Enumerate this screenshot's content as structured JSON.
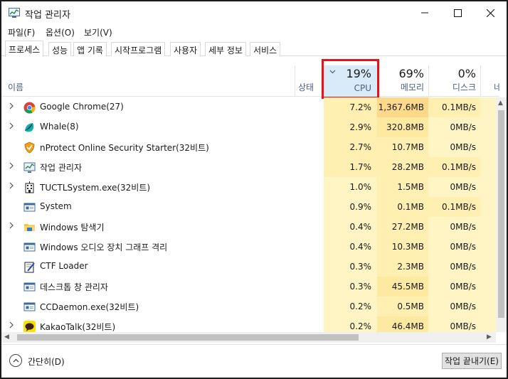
{
  "window": {
    "title": "작업 관리자"
  },
  "menu": [
    "파일(F)",
    "옵션(O)",
    "보기(V)"
  ],
  "tabs": [
    "프로세스",
    "성능",
    "앱 기록",
    "시작프로그램",
    "사용자",
    "세부 정보",
    "서비스"
  ],
  "columns": {
    "name": "이름",
    "status": "상태",
    "cpu": {
      "pct": "19%",
      "label": "CPU"
    },
    "memory": {
      "pct": "69%",
      "label": "메모리"
    },
    "disk": {
      "pct": "0%",
      "label": "디스크"
    },
    "network": {
      "label": "네트"
    }
  },
  "processes": [
    {
      "name": "Google Chrome(27)",
      "cpu": "7.2%",
      "mem": "1,367.6MB",
      "disk": "0.1MB/s",
      "net": "",
      "expand": true,
      "icon": "chrome-icon"
    },
    {
      "name": "Whale(8)",
      "cpu": "2.9%",
      "mem": "320.8MB",
      "disk": "0MB/s",
      "net": "",
      "expand": true,
      "icon": "whale-icon"
    },
    {
      "name": "nProtect Online Security Starter(32비트)",
      "cpu": "2.7%",
      "mem": "10.7MB",
      "disk": "0MB/s",
      "net": "",
      "expand": false,
      "icon": "shield-icon"
    },
    {
      "name": "작업 관리자",
      "cpu": "1.7%",
      "mem": "28.2MB",
      "disk": "0.1MB/s",
      "net": "",
      "expand": true,
      "icon": "task-manager-icon"
    },
    {
      "name": "TUCTLSystem.exe(32비트)",
      "cpu": "1.0%",
      "mem": "1.5MB",
      "disk": "0MB/s",
      "net": "",
      "expand": true,
      "icon": "building-icon"
    },
    {
      "name": "System",
      "cpu": "0.9%",
      "mem": "0.1MB",
      "disk": "0.1MB/s",
      "net": "",
      "expand": false,
      "icon": "window-app-icon"
    },
    {
      "name": "Windows 탐색기",
      "cpu": "0.4%",
      "mem": "27.2MB",
      "disk": "0MB/s",
      "net": "",
      "expand": true,
      "icon": "folder-icon"
    },
    {
      "name": "Windows 오디오 장치 그래프 격리",
      "cpu": "0.4%",
      "mem": "10.3MB",
      "disk": "0MB/s",
      "net": "",
      "expand": false,
      "icon": "window-app-icon"
    },
    {
      "name": "CTF Loader",
      "cpu": "0.3%",
      "mem": "2.3MB",
      "disk": "0MB/s",
      "net": "",
      "expand": false,
      "icon": "ctf-icon"
    },
    {
      "name": "데스크톱 창 관리자",
      "cpu": "0.3%",
      "mem": "45.5MB",
      "disk": "0MB/s",
      "net": "",
      "expand": false,
      "icon": "window-app-icon"
    },
    {
      "name": "CCDaemon.exe(32비트)",
      "cpu": "0.2%",
      "mem": "0.5MB",
      "disk": "0MB/s",
      "net": "",
      "expand": false,
      "icon": "window-app-icon"
    },
    {
      "name": "KakaoTalk(32비트)",
      "cpu": "0.2%",
      "mem": "46.4MB",
      "disk": "0MB/s",
      "net": "",
      "expand": true,
      "icon": "kakaotalk-icon"
    }
  ],
  "footer": {
    "collapse": "간단히(D)",
    "end_task": "작업 끝내기(E)"
  },
  "colors": {
    "highlight": "#e8111c",
    "cpu_header": "#d9ebf9",
    "heat_light": "#fff4c4",
    "heat_strong": "#ffd98a"
  }
}
